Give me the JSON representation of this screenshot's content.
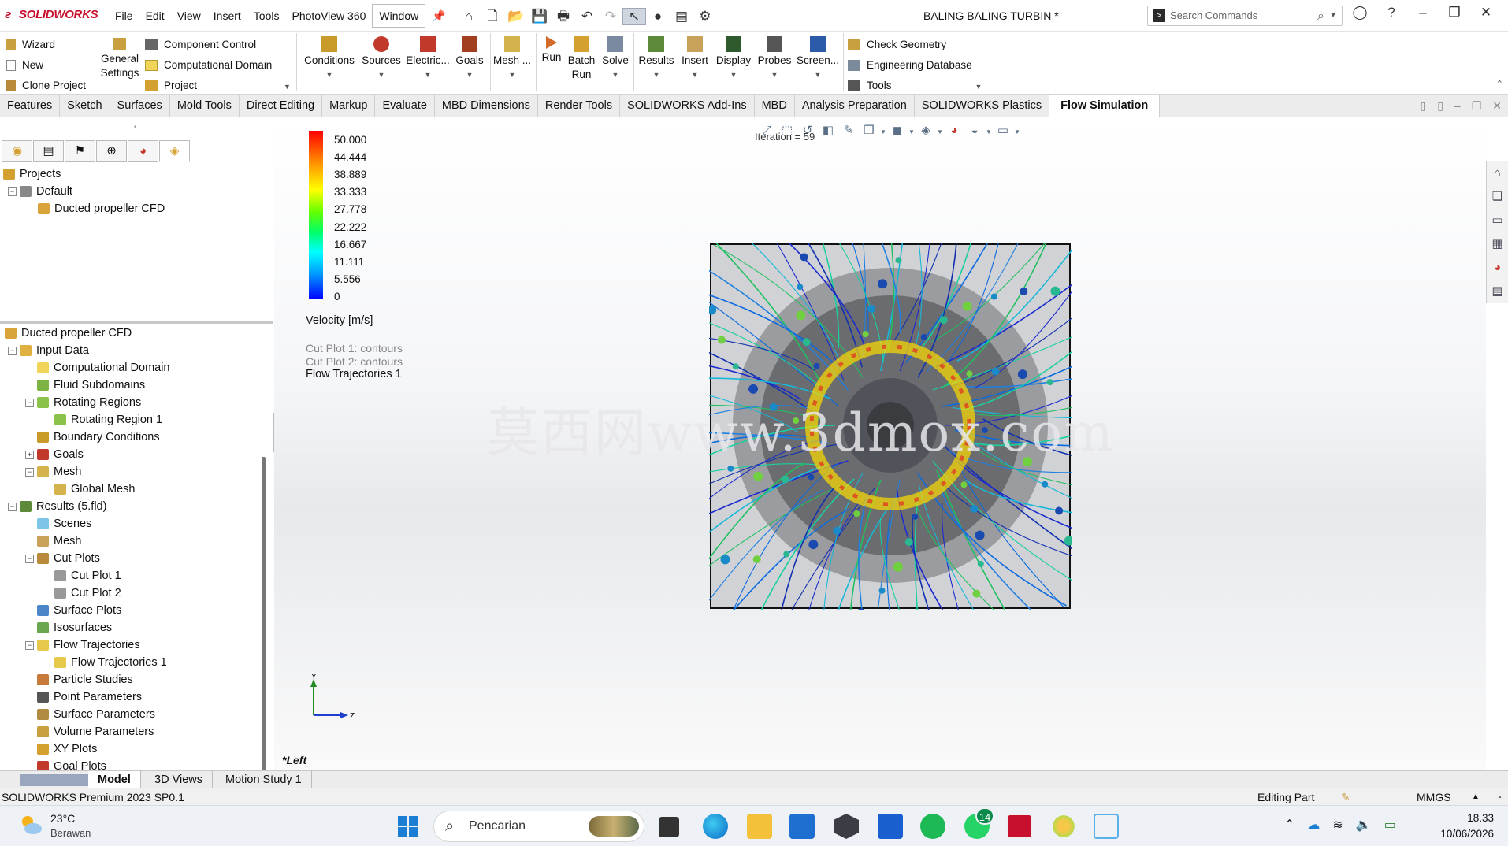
{
  "titlebar": {
    "app": "SOLIDWORKS",
    "menus": [
      "File",
      "Edit",
      "View",
      "Insert",
      "Tools",
      "PhotoView 360",
      "Window"
    ],
    "doc_title": "BALING BALING TURBIN *",
    "search_placeholder": "Search Commands"
  },
  "cmdmgr": {
    "col1": [
      "Wizard",
      "New",
      "Clone Project"
    ],
    "general_settings": [
      "General",
      "Settings"
    ],
    "col2": [
      "Component Control",
      "Computational Domain",
      "Project"
    ],
    "big": [
      {
        "label": "Conditions"
      },
      {
        "label": "Sources"
      },
      {
        "label": "Electric..."
      },
      {
        "label": "Goals"
      },
      {
        "label": "Mesh ..."
      },
      {
        "label": "Run"
      },
      {
        "label": "Batch",
        "label2": "Run"
      },
      {
        "label": "Solve"
      },
      {
        "label": "Results"
      },
      {
        "label": "Insert"
      },
      {
        "label": "Display"
      },
      {
        "label": "Probes"
      },
      {
        "label": "Screen..."
      }
    ],
    "col3": [
      "Check Geometry",
      "Engineering Database",
      "Tools"
    ]
  },
  "tabs": [
    "Features",
    "Sketch",
    "Surfaces",
    "Mold Tools",
    "Direct Editing",
    "Markup",
    "Evaluate",
    "MBD Dimensions",
    "Render Tools",
    "SOLIDWORKS Add-Ins",
    "MBD",
    "Analysis Preparation",
    "SOLIDWORKS Plastics",
    "Flow Simulation"
  ],
  "active_tab": "Flow Simulation",
  "projects_tree": {
    "root": "Projects",
    "default": "Default",
    "project": "Ducted propeller CFD"
  },
  "analysis_tree": [
    {
      "label": "Ducted propeller CFD",
      "level": 0,
      "exp": "-",
      "color": "#d9a53a"
    },
    {
      "label": "Input Data",
      "level": 1,
      "exp": "-",
      "color": "#e0b040"
    },
    {
      "label": "Computational Domain",
      "level": 2,
      "exp": "",
      "color": "#f1d55a"
    },
    {
      "label": "Fluid Subdomains",
      "level": 2,
      "exp": "",
      "color": "#7cb342"
    },
    {
      "label": "Rotating Regions",
      "level": 2,
      "exp": "-",
      "color": "#8bc34a"
    },
    {
      "label": "Rotating Region 1",
      "level": 3,
      "exp": "",
      "color": "#8bc34a"
    },
    {
      "label": "Boundary Conditions",
      "level": 2,
      "exp": "",
      "color": "#c79a2a"
    },
    {
      "label": "Goals",
      "level": 2,
      "exp": "+",
      "color": "#c0392b"
    },
    {
      "label": "Mesh",
      "level": 2,
      "exp": "-",
      "color": "#d4b24c"
    },
    {
      "label": "Global Mesh",
      "level": 3,
      "exp": "",
      "color": "#d4b24c"
    },
    {
      "label": "Results (5.fld)",
      "level": 1,
      "exp": "-",
      "color": "#5d8a3a"
    },
    {
      "label": "Scenes",
      "level": 2,
      "exp": "",
      "color": "#7cc4e8"
    },
    {
      "label": "Mesh",
      "level": 2,
      "exp": "",
      "color": "#c8a15a"
    },
    {
      "label": "Cut Plots",
      "level": 2,
      "exp": "-",
      "color": "#b88a3a"
    },
    {
      "label": "Cut Plot 1",
      "level": 3,
      "exp": "",
      "color": "#999999"
    },
    {
      "label": "Cut Plot 2",
      "level": 3,
      "exp": "",
      "color": "#999999"
    },
    {
      "label": "Surface Plots",
      "level": 2,
      "exp": "",
      "color": "#4a86c8"
    },
    {
      "label": "Isosurfaces",
      "level": 2,
      "exp": "",
      "color": "#6aa84f"
    },
    {
      "label": "Flow Trajectories",
      "level": 2,
      "exp": "-",
      "color": "#e6c84a"
    },
    {
      "label": "Flow Trajectories 1",
      "level": 3,
      "exp": "",
      "color": "#e6c84a"
    },
    {
      "label": "Particle Studies",
      "level": 2,
      "exp": "",
      "color": "#c87a3a"
    },
    {
      "label": "Point Parameters",
      "level": 2,
      "exp": "",
      "color": "#555555"
    },
    {
      "label": "Surface Parameters",
      "level": 2,
      "exp": "",
      "color": "#b08a40"
    },
    {
      "label": "Volume Parameters",
      "level": 2,
      "exp": "",
      "color": "#c8a040"
    },
    {
      "label": "XY Plots",
      "level": 2,
      "exp": "",
      "color": "#d4a030"
    },
    {
      "label": "Goal Plots",
      "level": 2,
      "exp": "",
      "color": "#c0392b"
    }
  ],
  "legend": {
    "values": [
      "50.000",
      "44.444",
      "38.889",
      "33.333",
      "27.778",
      "22.222",
      "16.667",
      "11.111",
      "5.556",
      "0"
    ],
    "unit": "Velocity [m/s]",
    "cut1": "Cut Plot 1: contours",
    "cut2": "Cut Plot 2: contours",
    "traj": "Flow Trajectories 1"
  },
  "viewport": {
    "iteration": "Iteration = 59",
    "view_name": "*Left",
    "watermark": "莫西网www.3dmox.com",
    "triad_y": "Y",
    "triad_z": "Z"
  },
  "bottom_tabs": [
    "Model",
    "3D Views",
    "Motion Study 1"
  ],
  "status": {
    "left": "SOLIDWORKS Premium 2023 SP0.1",
    "mode": "Editing Part",
    "units": "MMGS"
  },
  "taskbar": {
    "temp": "23°C",
    "weather": "Berawan",
    "search": "Pencarian",
    "whatsapp_badge": "14",
    "time": "18.33",
    "date": "10/06/2026"
  }
}
